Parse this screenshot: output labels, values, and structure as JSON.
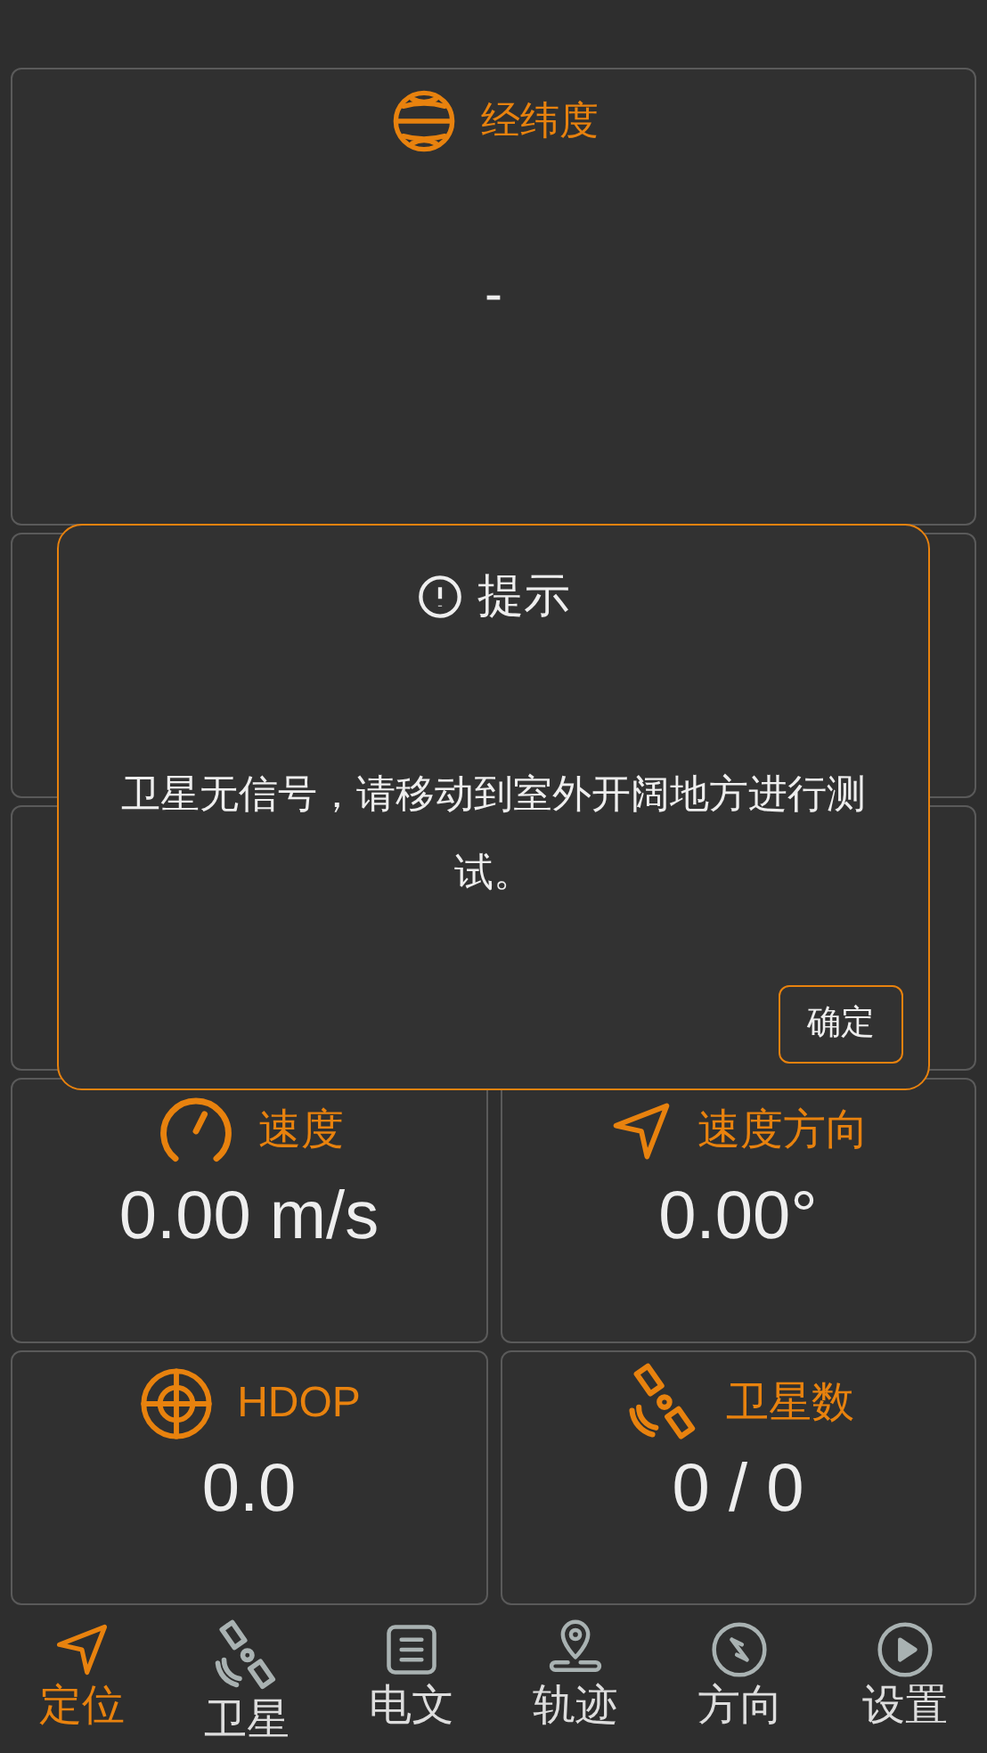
{
  "top_card": {
    "kind": "globe",
    "label": "经纬度",
    "value": "-"
  },
  "metrics": [
    {
      "kind": "speed",
      "label": "速度",
      "value": "0.00 m/s"
    },
    {
      "kind": "heading",
      "label": "速度方向",
      "value": "0.00°"
    },
    {
      "kind": "hdop",
      "label": "HDOP",
      "value": "0.0"
    },
    {
      "kind": "satellite",
      "label": "卫星数",
      "value": "0 / 0"
    }
  ],
  "dialog": {
    "title": "提示",
    "message": "卫星无信号，请移动到室外开阔地方进行测试。",
    "button": "确定"
  },
  "nav": [
    {
      "kind": "locate",
      "label": "定位",
      "selected": true
    },
    {
      "kind": "satellite",
      "label": "卫星",
      "selected": false
    },
    {
      "kind": "text",
      "label": "电文",
      "selected": false
    },
    {
      "kind": "track",
      "label": "轨迹",
      "selected": false
    },
    {
      "kind": "compass",
      "label": "方向",
      "selected": false
    },
    {
      "kind": "play",
      "label": "设置",
      "selected": false
    }
  ]
}
